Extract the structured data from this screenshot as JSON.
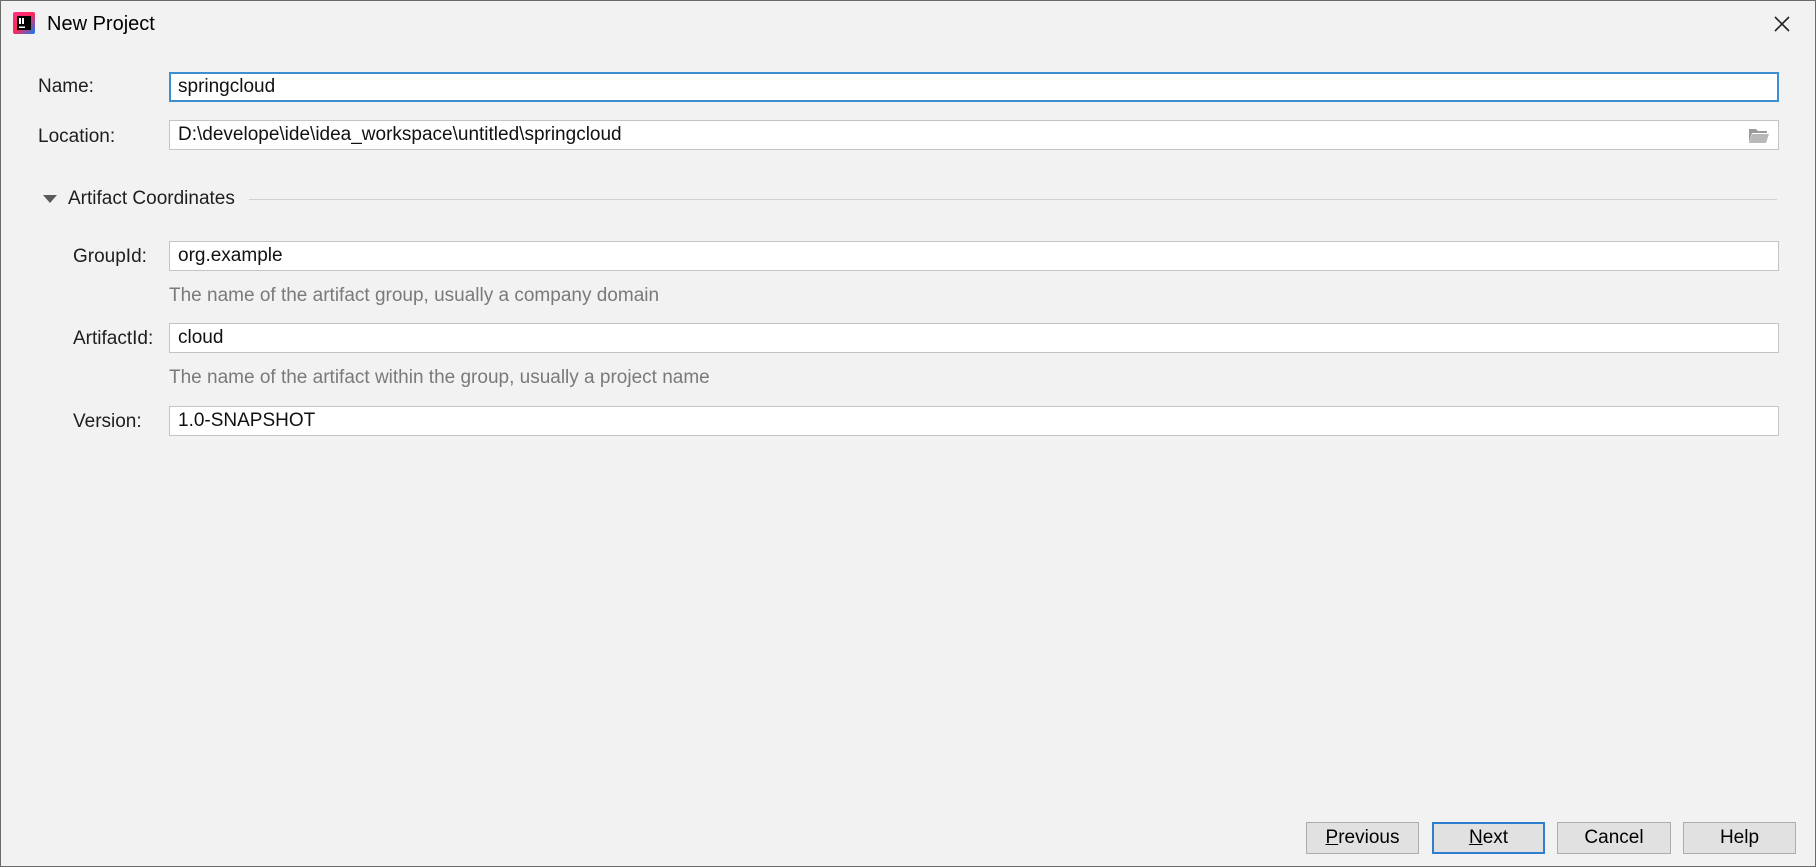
{
  "window": {
    "title": "New Project",
    "app_icon": "intellij-idea-icon",
    "close_icon": "close-icon"
  },
  "form": {
    "name": {
      "label": "Name:",
      "value": "springcloud"
    },
    "location": {
      "label": "Location:",
      "value": "D:\\develope\\ide\\idea_workspace\\untitled\\springcloud",
      "browse_icon": "folder-icon"
    }
  },
  "artifact_section": {
    "title": "Artifact Coordinates",
    "expanded": true,
    "toggle_icon": "triangle-down-icon",
    "group_id": {
      "label": "GroupId:",
      "value": "org.example",
      "hint": "The name of the artifact group, usually a company domain"
    },
    "artifact_id": {
      "label": "ArtifactId:",
      "value": "cloud",
      "hint": "The name of the artifact within the group, usually a project name"
    },
    "version": {
      "label": "Version:",
      "value": "1.0-SNAPSHOT"
    }
  },
  "buttons": {
    "previous": "Previous",
    "next": "Next",
    "cancel": "Cancel",
    "help": "Help"
  },
  "colors": {
    "background": "#f2f2f2",
    "focus_border": "#3d8fd1",
    "default_button_border": "#2f7fcf",
    "hint_text": "#7a7a7a"
  }
}
